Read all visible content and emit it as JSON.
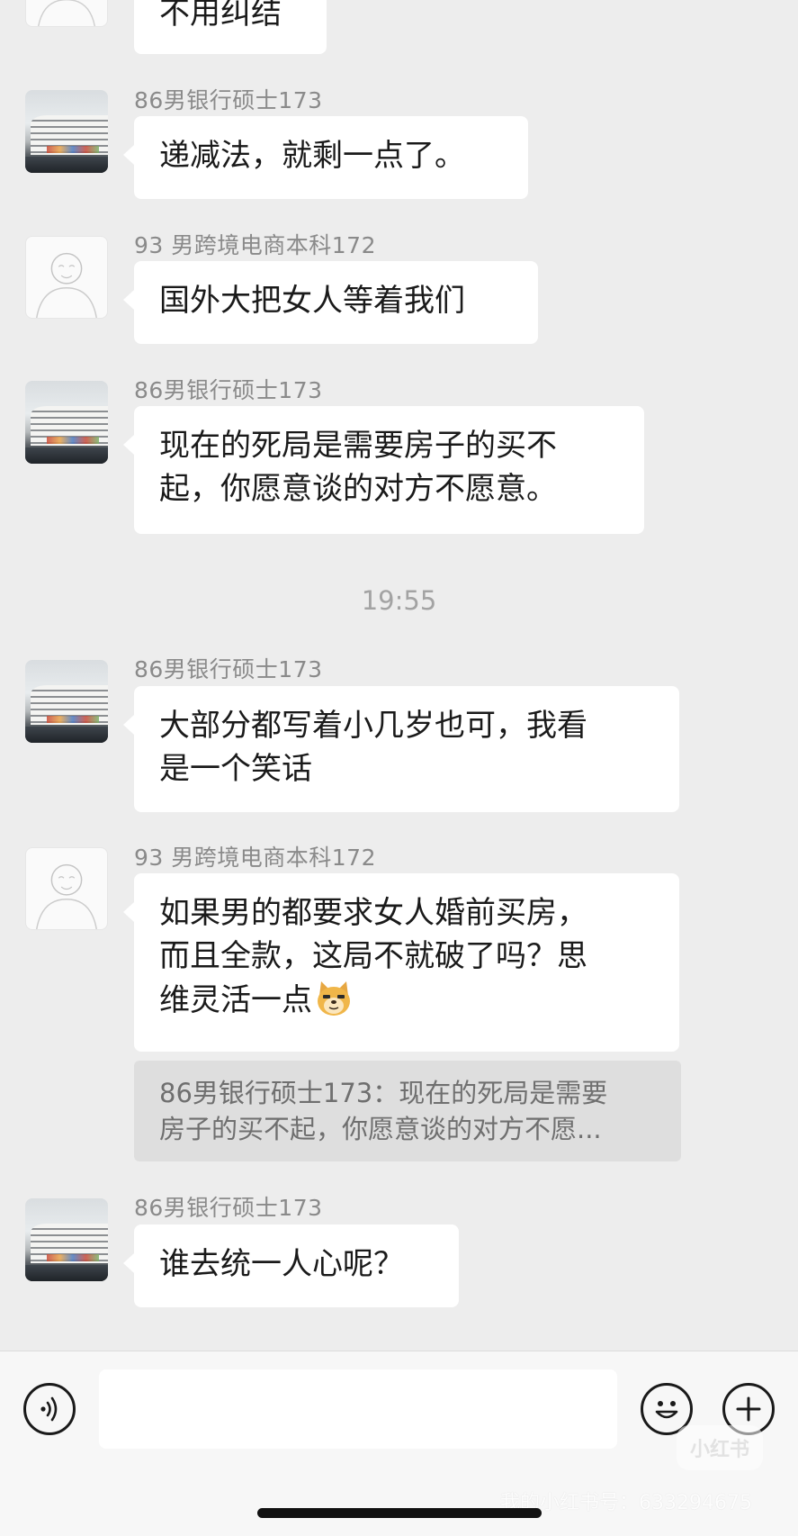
{
  "messages": [
    {
      "lines": [
        "不用纠结"
      ]
    },
    {
      "sender": "86男银行硕士173",
      "lines": [
        "递减法，就剩一点了。"
      ]
    },
    {
      "sender": "93 男跨境电商本科172",
      "lines": [
        "国外大把女人等着我们"
      ]
    },
    {
      "sender": "86男银行硕士173",
      "lines": [
        "现在的死局是需要房子的买不",
        "起，你愿意谈的对方不愿意。"
      ]
    },
    {
      "sender": "86男银行硕士173",
      "lines": [
        "大部分都写着小几岁也可，我看",
        "是一个笑话"
      ]
    },
    {
      "sender": "93 男跨境电商本科172",
      "lines": [
        "如果男的都要求女人婚前买房，",
        "而且全款，这局不就破了吗？思",
        "维灵活一点"
      ]
    },
    {
      "sender": "86男银行硕士173",
      "lines": [
        "谁去统一人心呢？"
      ]
    }
  ],
  "timestamp": "19:55",
  "quote": {
    "line1": "86男银行硕士173：现在的死局是需要",
    "line2": "房子的买不起，你愿意谈的对方不愿..."
  },
  "icons": {
    "voice": "voice-input-icon",
    "emoji": "smiley-face-icon",
    "plus": "plus-icon",
    "doge": "doge-emoji"
  },
  "watermark": {
    "logo": "小红书",
    "id": "我的小红书号：633294675"
  }
}
